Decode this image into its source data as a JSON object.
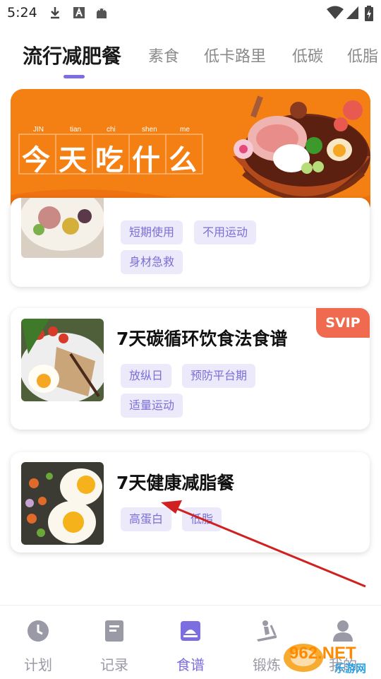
{
  "status_bar": {
    "time": "5:24"
  },
  "tabs": [
    {
      "label": "流行减肥餐"
    },
    {
      "label": "素食"
    },
    {
      "label": "低卡路里"
    },
    {
      "label": "低碳"
    },
    {
      "label": "低脂"
    }
  ],
  "banner": {
    "pinyin": [
      "JIN",
      "tian",
      "chi",
      "shen",
      "me"
    ],
    "title_chars": [
      "今",
      "天",
      "吃",
      "什",
      "么"
    ]
  },
  "cards": [
    {
      "title": "",
      "tags": [
        "短期使用",
        "不用运动",
        "身材急救"
      ]
    },
    {
      "title": "7天碳循环饮食法食谱",
      "badge": "SVIP",
      "tags": [
        "放纵日",
        "预防平台期",
        "适量运动"
      ]
    },
    {
      "title": "7天健康减脂餐",
      "tags": [
        "高蛋白",
        "低脂"
      ]
    }
  ],
  "bottom_nav": [
    {
      "label": "计划",
      "icon": "clock-icon"
    },
    {
      "label": "记录",
      "icon": "notebook-icon"
    },
    {
      "label": "食谱",
      "icon": "recipe-book-icon"
    },
    {
      "label": "锻炼",
      "icon": "treadmill-icon"
    },
    {
      "label": "我的",
      "icon": "person-icon"
    }
  ],
  "watermark": {
    "text": "962.NET",
    "subtext": "乐游网"
  },
  "colors": {
    "accent": "#7c6ee0",
    "banner": "#f47f12",
    "svip": "#ef6a4f",
    "tag_bg": "#ece9fb",
    "tag_text": "#7a6fd6",
    "arrow": "#d02020"
  }
}
